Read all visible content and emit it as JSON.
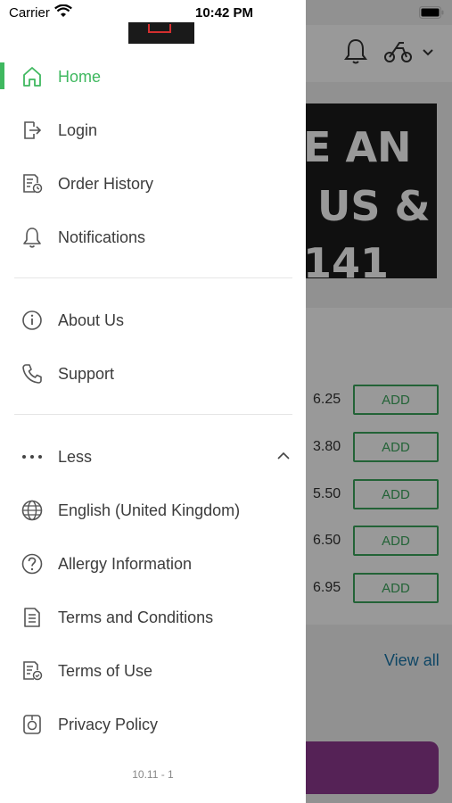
{
  "status_bar": {
    "carrier": "Carrier",
    "time": "10:42 PM"
  },
  "drawer": {
    "primary_items": [
      {
        "label": "Home",
        "icon": "home-icon",
        "active": true
      },
      {
        "label": "Login",
        "icon": "login-icon"
      },
      {
        "label": "Order History",
        "icon": "order-history-icon"
      },
      {
        "label": "Notifications",
        "icon": "bell-icon"
      }
    ],
    "secondary_items": [
      {
        "label": "About Us",
        "icon": "info-icon"
      },
      {
        "label": "Support",
        "icon": "phone-icon"
      }
    ],
    "more_toggle": {
      "label": "Less",
      "icon": "more-dots-icon",
      "chevron": "chevron-up-icon"
    },
    "extra_items": [
      {
        "label": "English (United Kingdom)",
        "icon": "globe-icon"
      },
      {
        "label": "Allergy Information",
        "icon": "question-icon"
      },
      {
        "label": "Terms and Conditions",
        "icon": "document-icon"
      },
      {
        "label": "Terms of Use",
        "icon": "document-check-icon"
      },
      {
        "label": "Privacy Policy",
        "icon": "privacy-icon"
      }
    ],
    "version": "10.11 - 1",
    "accent_color": "#3fb85f"
  },
  "background": {
    "banner_lines": [
      "E AN",
      "US &",
      "141"
    ],
    "prices": [
      "6.25",
      "3.80",
      "5.50",
      "6.50",
      "6.95"
    ],
    "add_label": "ADD",
    "view_all": "View all",
    "button_color": "#8e3a8f"
  }
}
